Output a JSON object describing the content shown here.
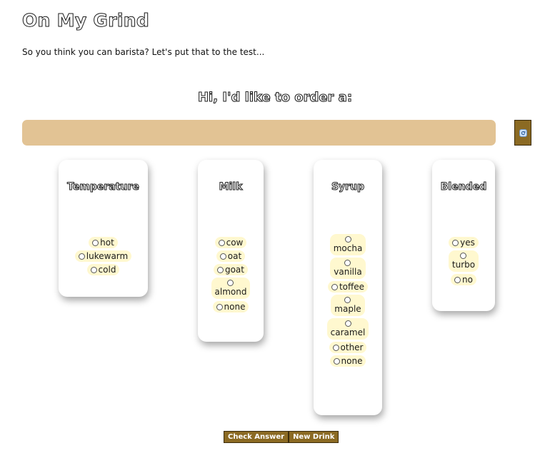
{
  "header": {
    "title": "On My Grind",
    "tagline": "So you think you can barista? Let's put that to the test..."
  },
  "order": {
    "heading": "Hi, I'd like to order a:",
    "text": ""
  },
  "refresh": {
    "icon": "refresh-icon"
  },
  "categories": {
    "temperature": {
      "title": "Temperature",
      "options": [
        "hot",
        "lukewarm",
        "cold"
      ]
    },
    "milk": {
      "title": "Milk",
      "options": [
        "cow",
        "oat",
        "goat",
        "almond",
        "none"
      ]
    },
    "syrup": {
      "title": "Syrup",
      "options": [
        "mocha",
        "vanilla",
        "toffee",
        "maple",
        "caramel",
        "other",
        "none"
      ]
    },
    "blended": {
      "title": "Blended",
      "options": [
        "yes",
        "turbo",
        "no"
      ]
    }
  },
  "buttons": {
    "check_answer": "Check Answer",
    "new_drink": "New Drink"
  },
  "colors": {
    "order_bar": "#e2c394",
    "button_brown": "#8b6a23",
    "option_bg": "#fff8cf"
  }
}
